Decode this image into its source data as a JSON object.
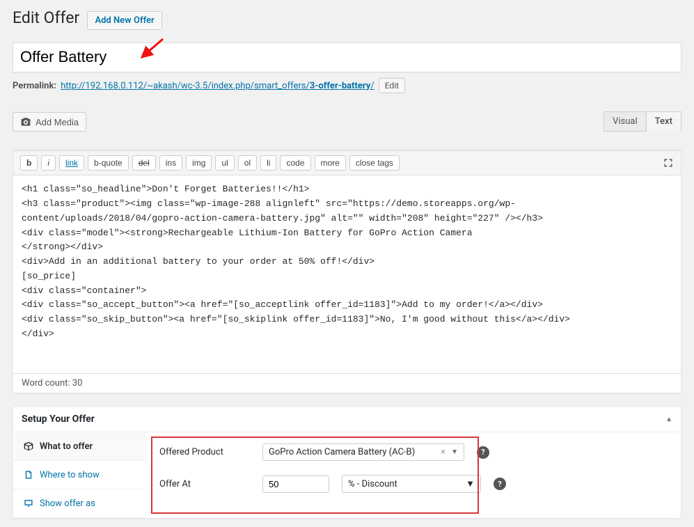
{
  "header": {
    "pageTitle": "Edit Offer",
    "addNew": "Add New Offer"
  },
  "title": {
    "value": "Offer Battery"
  },
  "permalink": {
    "label": "Permalink:",
    "urlPrefix": "http://192.168.0.112/~akash/wc-3.5/index.php/smart_offers/",
    "slug": "3-offer-battery",
    "slash": "/",
    "edit": "Edit"
  },
  "media": {
    "addMedia": "Add Media"
  },
  "editor": {
    "tabs": {
      "visual": "Visual",
      "text": "Text"
    },
    "toolbar": {
      "b": "b",
      "i": "i",
      "link": "link",
      "bquote": "b-quote",
      "del": "del",
      "ins": "ins",
      "img": "img",
      "ul": "ul",
      "ol": "ol",
      "li": "li",
      "code": "code",
      "more": "more",
      "close": "close tags"
    },
    "content": "<h1 class=\"so_headline\">Don't Forget Batteries!!</h1>\n<h3 class=\"product\"><img class=\"wp-image-288 alignleft\" src=\"https://demo.storeapps.org/wp-content/uploads/2018/04/gopro-action-camera-battery.jpg\" alt=\"\" width=\"208\" height=\"227\" /></h3>\n<div class=\"model\"><strong>Rechargeable Lithium-Ion Battery for GoPro Action Camera\n</strong></div>\n<div>Add in an additional battery to your order at 50% off!</div>\n[so_price]\n<div class=\"container\">\n<div class=\"so_accept_button\"><a href=\"[so_acceptlink offer_id=1183]\">Add to my order!</a></div>\n<div class=\"so_skip_button\"><a href=\"[so_skiplink offer_id=1183]\">No, I'm good without this</a></div>\n</div>",
    "wordCountLabel": "Word count: 30"
  },
  "offerbox": {
    "title": "Setup Your Offer",
    "tabs": {
      "what": "What to offer",
      "where": "Where to show",
      "as": "Show offer as"
    },
    "form": {
      "productLabel": "Offered Product",
      "productValue": "GoPro Action Camera Battery (AC-B)",
      "offerAtLabel": "Offer At",
      "offerAtValue": "50",
      "discountType": "% - Discount"
    }
  }
}
